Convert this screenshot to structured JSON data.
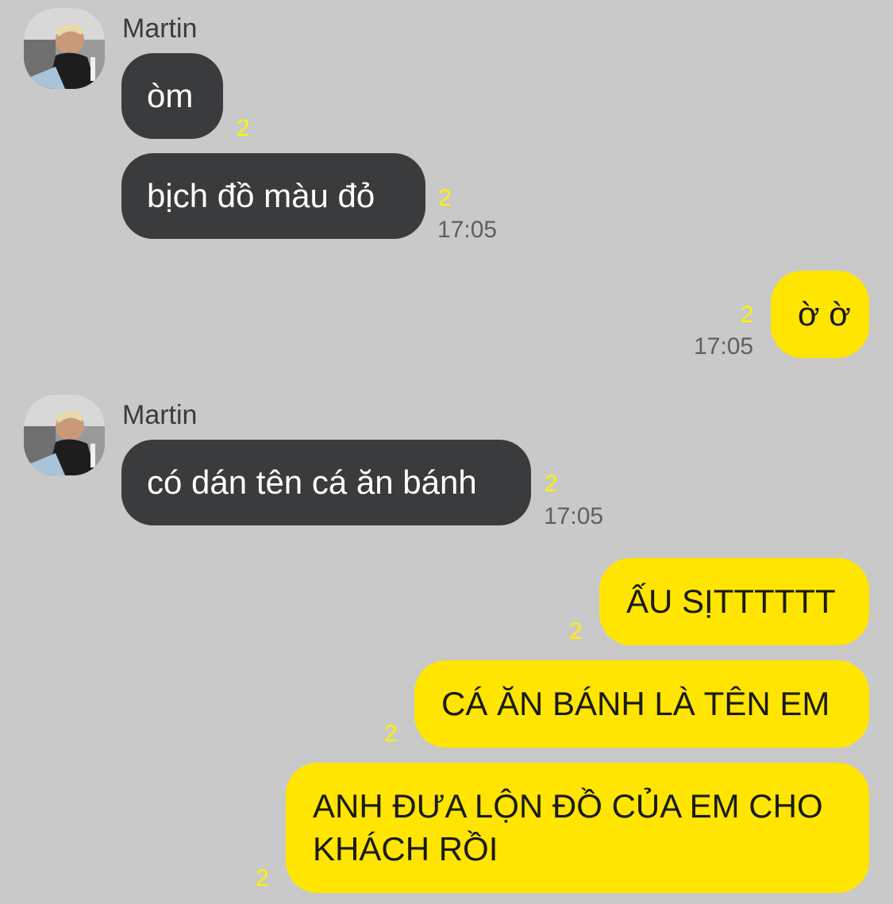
{
  "messages": [
    {
      "sender": "Martin",
      "text": "òm",
      "unread": "2",
      "time": ""
    },
    {
      "text": "bịch đồ màu đỏ",
      "unread": "2",
      "time": "17:05"
    },
    {
      "text": "ờ ờ",
      "unread": "2",
      "time": "17:05"
    },
    {
      "sender": "Martin",
      "text": "có dán tên cá ăn bánh",
      "unread": "2",
      "time": "17:05"
    },
    {
      "text": "ẤU SỊTTTTTT",
      "unread": "2"
    },
    {
      "text": "CÁ ĂN BÁNH LÀ TÊN EM",
      "unread": "2"
    },
    {
      "text_line1": "ANH ĐƯA LỘN ĐỒ CỦA EM CHO",
      "text_line2": "KHÁCH RỒI",
      "unread": "2"
    }
  ],
  "colors": {
    "background": "#c9c9c9",
    "incoming_bubble": "#3a3b3d",
    "outgoing_bubble": "#ffe500",
    "unread_count": "#fff200"
  },
  "icons": {
    "avatar": "user-photo-avatar"
  }
}
